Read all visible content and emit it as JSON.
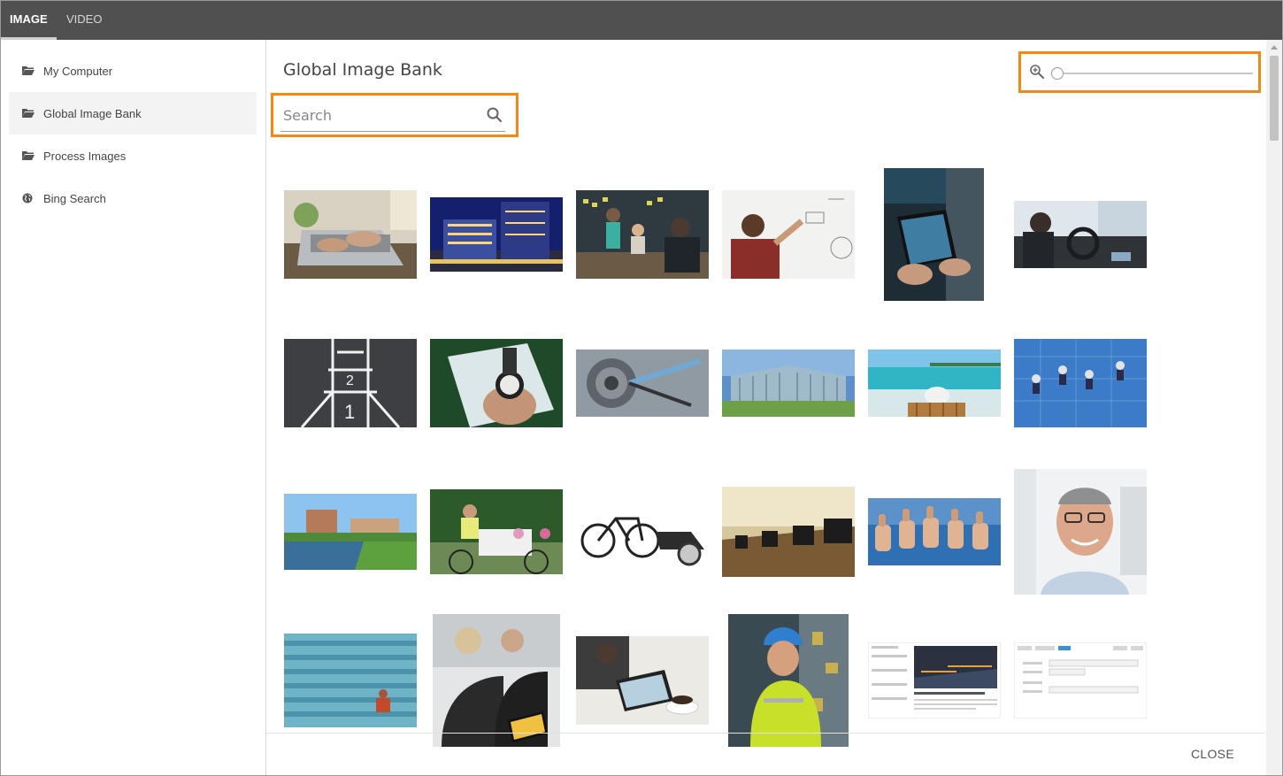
{
  "tabs": [
    {
      "label": "IMAGE",
      "active": true
    },
    {
      "label": "VIDEO",
      "active": false
    }
  ],
  "sidebar": {
    "items": [
      {
        "label": "My Computer",
        "icon": "folder-icon",
        "active": false
      },
      {
        "label": "Global Image Bank",
        "icon": "folder-icon",
        "active": true
      },
      {
        "label": "Process Images",
        "icon": "folder-icon",
        "active": false
      },
      {
        "label": "Bing Search",
        "icon": "globe-icon",
        "active": false
      }
    ]
  },
  "main": {
    "title": "Global Image Bank",
    "search": {
      "placeholder": "Search",
      "value": ""
    },
    "zoom": {
      "level": 0
    }
  },
  "highlight_color": "#f7870f",
  "images": [
    {
      "subject": "laptop-typing"
    },
    {
      "subject": "hotel-night"
    },
    {
      "subject": "meeting-presentation"
    },
    {
      "subject": "man-whiteboard"
    },
    {
      "subject": "tablet-in-hands"
    },
    {
      "subject": "car-interior"
    },
    {
      "subject": "hopscotch-road"
    },
    {
      "subject": "compass-map"
    },
    {
      "subject": "bicycle-gears"
    },
    {
      "subject": "glass-building"
    },
    {
      "subject": "beach-chair"
    },
    {
      "subject": "window-cleaners"
    },
    {
      "subject": "campus-lake"
    },
    {
      "subject": "family-cargo-bike"
    },
    {
      "subject": "bike-trailer"
    },
    {
      "subject": "office-desks"
    },
    {
      "subject": "thumbs-up"
    },
    {
      "subject": "smiling-man"
    },
    {
      "subject": "stadium-seats"
    },
    {
      "subject": "workers-tablet"
    },
    {
      "subject": "tablet-coffee"
    },
    {
      "subject": "engineer-hardhat"
    },
    {
      "subject": "news-screenshot"
    },
    {
      "subject": "form-screenshot"
    }
  ],
  "footer": {
    "close_label": "CLOSE"
  }
}
